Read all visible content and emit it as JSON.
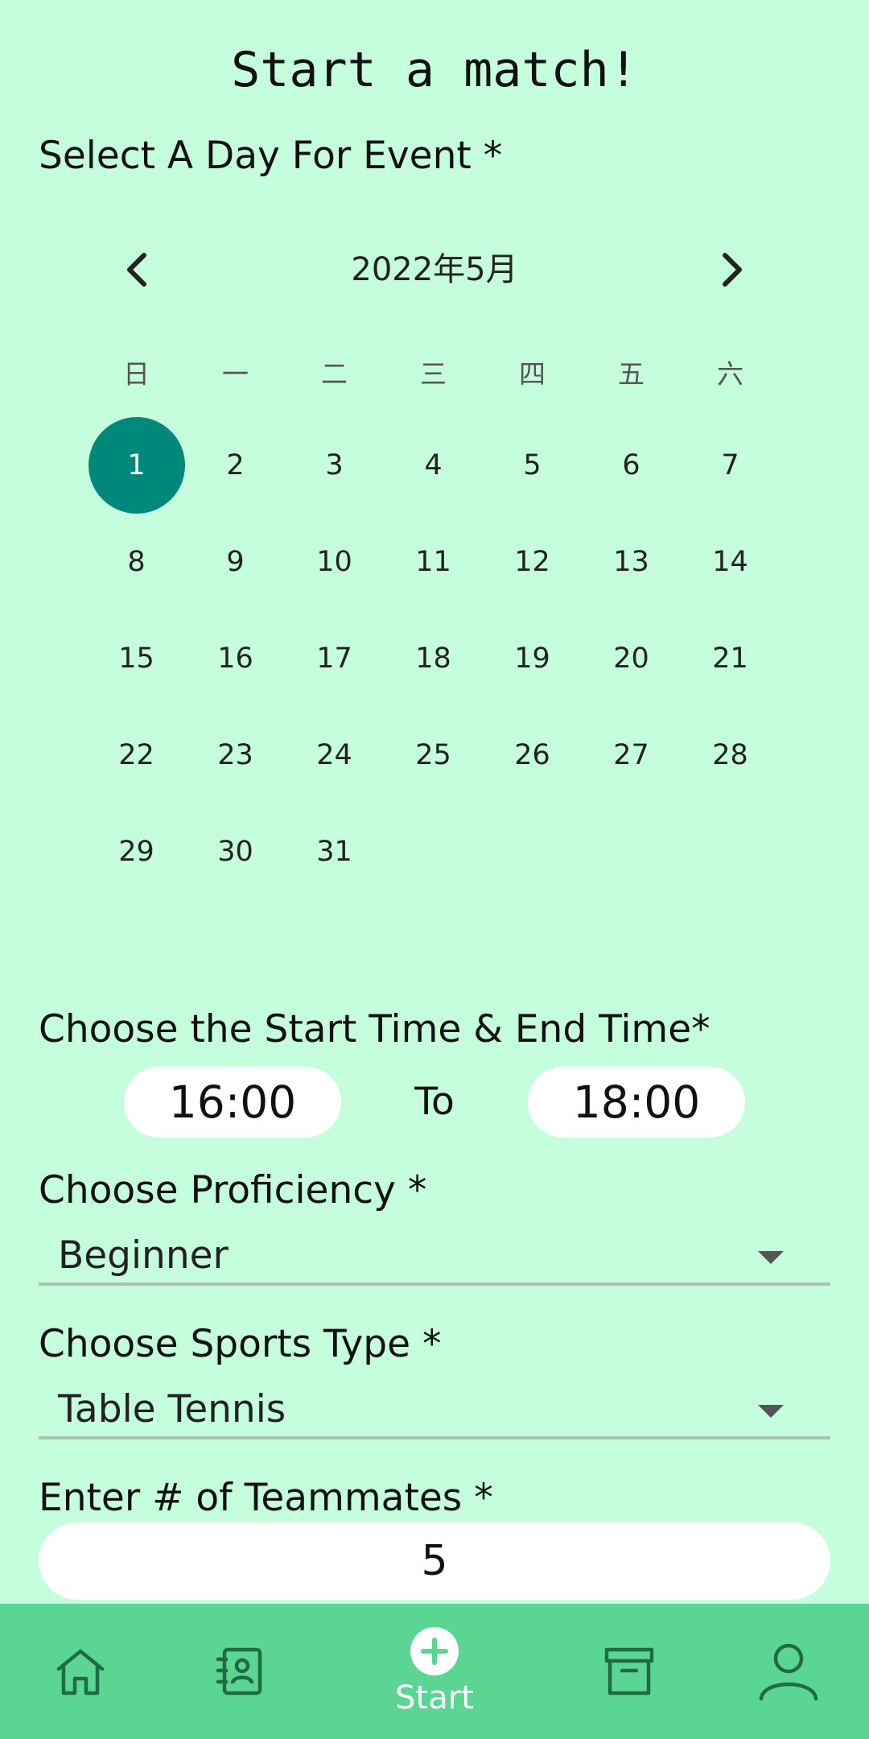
{
  "page": {
    "title": "Start a match!"
  },
  "calendar": {
    "label": "Select A Day For Event *",
    "month_label": "2022年5月",
    "weekdays": [
      "日",
      "一",
      "二",
      "三",
      "四",
      "五",
      "六"
    ],
    "days": [
      "1",
      "2",
      "3",
      "4",
      "5",
      "6",
      "7",
      "8",
      "9",
      "10",
      "11",
      "12",
      "13",
      "14",
      "15",
      "16",
      "17",
      "18",
      "19",
      "20",
      "21",
      "22",
      "23",
      "24",
      "25",
      "26",
      "27",
      "28",
      "29",
      "30",
      "31"
    ],
    "selected_day": "1",
    "accent_color": "#00897b"
  },
  "time": {
    "label": "Choose the Start Time & End Time*",
    "start": "16:00",
    "separator": "To",
    "end": "18:00"
  },
  "proficiency": {
    "label": "Choose Proficiency *",
    "value": "Beginner"
  },
  "sports": {
    "label": "Choose Sports Type *",
    "value": "Table Tennis"
  },
  "teammates": {
    "label": "Enter # of Teammates *",
    "value": "5"
  },
  "nav": {
    "start_label": "Start",
    "items": [
      "home-icon",
      "contacts-icon",
      "add-icon",
      "archive-icon",
      "profile-icon"
    ],
    "background": "#5ad692"
  }
}
